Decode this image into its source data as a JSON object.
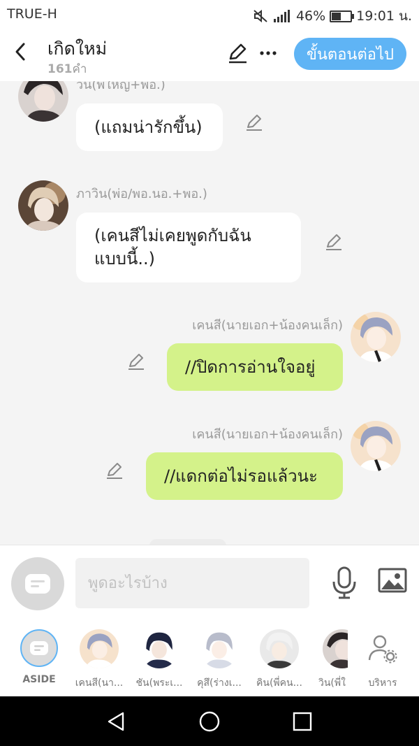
{
  "status": {
    "carrier": "TRUE-H",
    "battery": "46%",
    "time": "19:01 น.",
    "battery_level": 0.46
  },
  "header": {
    "title": "เกิดใหม่",
    "word_count_num": "161",
    "word_count_unit": "คำ",
    "next_button": "ขั้นตอนต่อไป"
  },
  "messages": [
    {
      "speaker": "วิน(พี่ใหญ่+พอ.)",
      "text": "(แถมน่ารักขึ้น)"
    },
    {
      "speaker": "ภาวิน(พ่อ/พอ.นอ.+พอ.)",
      "text_line1": "(เคนสีไม่เคยพูดกับฉัน",
      "text_line2": "แบบนี้..)"
    },
    {
      "speaker": "เคนสี(นายเอก+น้องคนเล็ก)",
      "text": "//ปิดการอ่านใจอยู่"
    },
    {
      "speaker": "เคนสี(นายเอก+น้องคนเล็ก)",
      "text": "//แดกต่อไม่รอแล้วนะ"
    }
  ],
  "input": {
    "placeholder": "พูดอะไรบ้าง"
  },
  "characters": [
    {
      "label": "ASIDE"
    },
    {
      "label": "เคนสี(นา..."
    },
    {
      "label": "ชัน(พระเ..."
    },
    {
      "label": "คุสึ(ร่างเ..."
    },
    {
      "label": "คิน(พี่คน..."
    },
    {
      "label": "วิน(พี่ใ"
    },
    {
      "label": "บริหาร"
    }
  ],
  "colors": {
    "accent": "#5fb4f5",
    "my_bubble": "#d4f28a",
    "other_bubble": "#ffffff"
  }
}
